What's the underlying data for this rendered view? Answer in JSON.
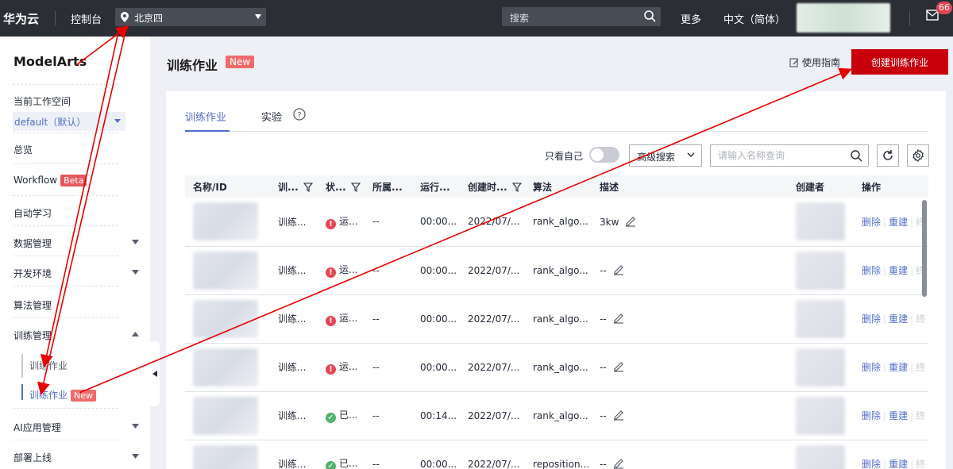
{
  "topbar": {
    "brand": "华为云",
    "console": "控制台",
    "region": "北京四",
    "search_placeholder": "搜索",
    "more": "更多",
    "language": "中文（简体）",
    "mail_badge": "66"
  },
  "sidebar": {
    "title": "ModelArts",
    "workspace_label": "当前工作空间",
    "workspace_value": "default（默认）",
    "items": [
      {
        "label": "总览"
      },
      {
        "label": "Workflow",
        "tag": "Beta"
      },
      {
        "label": "自动学习"
      },
      {
        "label": "数据管理"
      },
      {
        "label": "开发环境"
      },
      {
        "label": "算法管理"
      },
      {
        "label": "训练管理"
      },
      {
        "label": "AI应用管理"
      },
      {
        "label": "部署上线"
      }
    ],
    "sub_items": [
      {
        "label": "训练作业"
      },
      {
        "label": "训练作业",
        "tag": "New"
      }
    ]
  },
  "header": {
    "title": "训练作业",
    "title_tag": "New",
    "guide": "使用指南",
    "create_button": "创建训练作业"
  },
  "tabs": [
    {
      "label": "训练作业"
    },
    {
      "label": "实验"
    }
  ],
  "toolbar": {
    "only_me": "只看自己",
    "advanced_search": "高级搜索",
    "search_placeholder": "请输入名称查询"
  },
  "table": {
    "columns": [
      "名称/ID",
      "训...",
      "状...",
      "所属...",
      "运行...",
      "创建时...",
      "算法",
      "描述",
      "创建者",
      "操作"
    ],
    "rows": [
      {
        "type": "训练...",
        "status": "运...",
        "status_kind": "error",
        "belong": "--",
        "duration": "00:00...",
        "created": "2022/07/...",
        "algorithm": "rank_algo...",
        "desc": "3kw",
        "ops": [
          "删除",
          "重建",
          "终"
        ]
      },
      {
        "type": "训练...",
        "status": "运...",
        "status_kind": "error",
        "belong": "--",
        "duration": "00:00...",
        "created": "2022/07/...",
        "algorithm": "rank_algo...",
        "desc": "--",
        "ops": [
          "删除",
          "重建",
          "终"
        ]
      },
      {
        "type": "训练...",
        "status": "运...",
        "status_kind": "error",
        "belong": "--",
        "duration": "00:00...",
        "created": "2022/07/...",
        "algorithm": "rank_algo...",
        "desc": "--",
        "ops": [
          "删除",
          "重建",
          "终"
        ]
      },
      {
        "type": "训练...",
        "status": "运...",
        "status_kind": "error",
        "belong": "--",
        "duration": "00:00...",
        "created": "2022/07/...",
        "algorithm": "rank_algo...",
        "desc": "--",
        "ops": [
          "删除",
          "重建",
          "终"
        ]
      },
      {
        "type": "训练...",
        "status": "已...",
        "status_kind": "ok",
        "belong": "--",
        "duration": "00:14...",
        "created": "2022/07/...",
        "algorithm": "rank_algo...",
        "desc": "--",
        "ops": [
          "删除",
          "重建",
          "终"
        ]
      },
      {
        "type": "训练...",
        "status": "已...",
        "status_kind": "ok",
        "belong": "--",
        "duration": "00:00...",
        "created": "2022/07/...",
        "algorithm": "reposition...",
        "desc": "--",
        "ops": [
          "删除",
          "重建",
          "终"
        ]
      }
    ]
  },
  "colors": {
    "topbar": "#2b2e35",
    "accent": "#526ecc",
    "primary_button": "#c7000b",
    "annotation_arrow": "#e60000"
  }
}
